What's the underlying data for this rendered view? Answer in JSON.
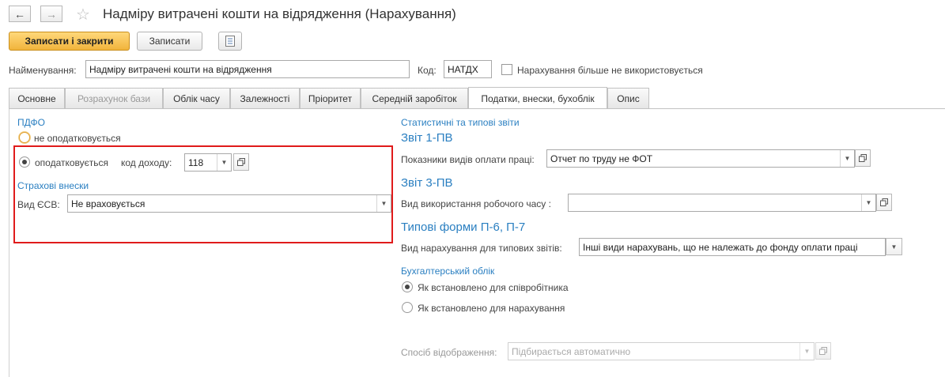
{
  "window": {
    "title": "Надміру витрачені кошти на відрядження (Нарахування)",
    "back_icon": "arrow-left-icon",
    "forward_icon": "arrow-right-icon",
    "favorite_icon": "star-icon"
  },
  "toolbar": {
    "save_close_label": "Записати і закрити",
    "save_label": "Записати",
    "report_icon": "document-list-icon"
  },
  "header_fields": {
    "name_label": "Найменування:",
    "name_value": "Надміру витрачені кошти на відрядження",
    "code_label": "Код:",
    "code_value": "НАТДХ",
    "unused_checkbox_label": "Нарахування більше не використовується",
    "unused_checked": false
  },
  "tabs": [
    {
      "label": "Основне",
      "state": "normal"
    },
    {
      "label": "Розрахунок бази",
      "state": "disabled"
    },
    {
      "label": "Облік часу",
      "state": "normal"
    },
    {
      "label": "Залежності",
      "state": "normal"
    },
    {
      "label": "Пріоритет",
      "state": "normal"
    },
    {
      "label": "Середній заробіток",
      "state": "normal"
    },
    {
      "label": "Податки, внески, бухоблік",
      "state": "active"
    },
    {
      "label": "Опис",
      "state": "normal"
    }
  ],
  "left": {
    "pdfo_title": "ПДФО",
    "not_taxed_label": "не оподатковується",
    "taxed_label": "оподатковується",
    "taxed_selected": true,
    "income_code_label": "код доходу:",
    "income_code_value": "118",
    "insurance_title": "Страхові внески",
    "esv_label": "Вид ЄСВ:",
    "esv_value": "Не враховується"
  },
  "right": {
    "stats_title": "Статистичні та типові звіти",
    "report_1pv_title": "Звіт 1-ПВ",
    "pay_types_label": "Показники видів оплати праці:",
    "pay_types_value": "Отчет по труду не ФОТ",
    "report_3pv_title": "Звіт 3-ПВ",
    "work_time_label": "Вид використання робочого часу :",
    "work_time_value": "",
    "forms_title": "Типові форми П-6, П-7",
    "accrual_type_label": "Вид нарахування для типових звітів:",
    "accrual_type_value": "Інші види нарахувань, що не належать до фонду оплати праці",
    "accounting_title": "Бухгалтерський облік",
    "as_employee_label": "Як встановлено для співробітника",
    "as_accrual_label": "Як встановлено для нарахування",
    "accounting_selected": "employee",
    "display_label": "Спосіб відображення:",
    "display_placeholder": "Підбирається автоматично"
  }
}
